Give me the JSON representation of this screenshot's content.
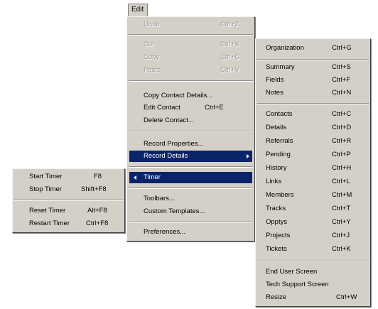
{
  "menubar": {
    "edit_label": "Edit"
  },
  "edit_menu": {
    "undo": {
      "label": "Undo",
      "shortcut": "Ctrl+Z"
    },
    "cut": {
      "label": "Cut",
      "shortcut": "Ctrl+X"
    },
    "copy": {
      "label": "Copy",
      "shortcut": "Ctrl+C"
    },
    "paste": {
      "label": "Paste",
      "shortcut": "Ctrl+V"
    },
    "copy_contact_details": {
      "label": "Copy Contact Details..."
    },
    "edit_contact": {
      "label": "Edit Contact",
      "shortcut": "Ctrl+E"
    },
    "delete_contact": {
      "label": "Delete Contact..."
    },
    "record_properties": {
      "label": "Record Properties..."
    },
    "record_details": {
      "label": "Record Details"
    },
    "timer": {
      "label": "Timer"
    },
    "toolbars": {
      "label": "Toolbars..."
    },
    "custom_templates": {
      "label": "Custom Templates..."
    },
    "preferences": {
      "label": "Preferences..."
    }
  },
  "timer_menu": [
    {
      "label": "Start Timer",
      "shortcut": "F8"
    },
    {
      "label": "Stop Timer",
      "shortcut": "Shift+F8"
    },
    {
      "label": "Reset Timer",
      "shortcut": "Alt+F8"
    },
    {
      "label": "Restart Timer",
      "shortcut": "Ctrl+F8"
    }
  ],
  "record_details_menu": {
    "group1": [
      {
        "label": "Organization",
        "shortcut": "Ctrl+G"
      }
    ],
    "group2": [
      {
        "label": "Summary",
        "shortcut": "Ctrl+S"
      },
      {
        "label": "Fields",
        "shortcut": "Ctrl+F"
      },
      {
        "label": "Notes",
        "shortcut": "Ctrl+N"
      }
    ],
    "group3": [
      {
        "label": "Contacts",
        "shortcut": "Ctrl+C"
      },
      {
        "label": "Details",
        "shortcut": "Ctrl+D"
      },
      {
        "label": "Referrals",
        "shortcut": "Ctrl+R"
      },
      {
        "label": "Pending",
        "shortcut": "Ctrl+P"
      },
      {
        "label": "History",
        "shortcut": "Ctrl+H"
      },
      {
        "label": "Links",
        "shortcut": "Ctrl+L"
      },
      {
        "label": "Members",
        "shortcut": "Ctrl+M"
      },
      {
        "label": "Tracks",
        "shortcut": "Ctrl+T"
      },
      {
        "label": "Opptys",
        "shortcut": "Ctrl+Y"
      },
      {
        "label": "Projects",
        "shortcut": "Ctrl+J"
      },
      {
        "label": "Tickets",
        "shortcut": "Ctrl+K"
      }
    ],
    "group4": [
      {
        "label": "End User Screen",
        "shortcut": ""
      },
      {
        "label": "Tech Support Screen",
        "shortcut": ""
      },
      {
        "label": "Resize",
        "shortcut": "Ctrl+W"
      }
    ]
  }
}
